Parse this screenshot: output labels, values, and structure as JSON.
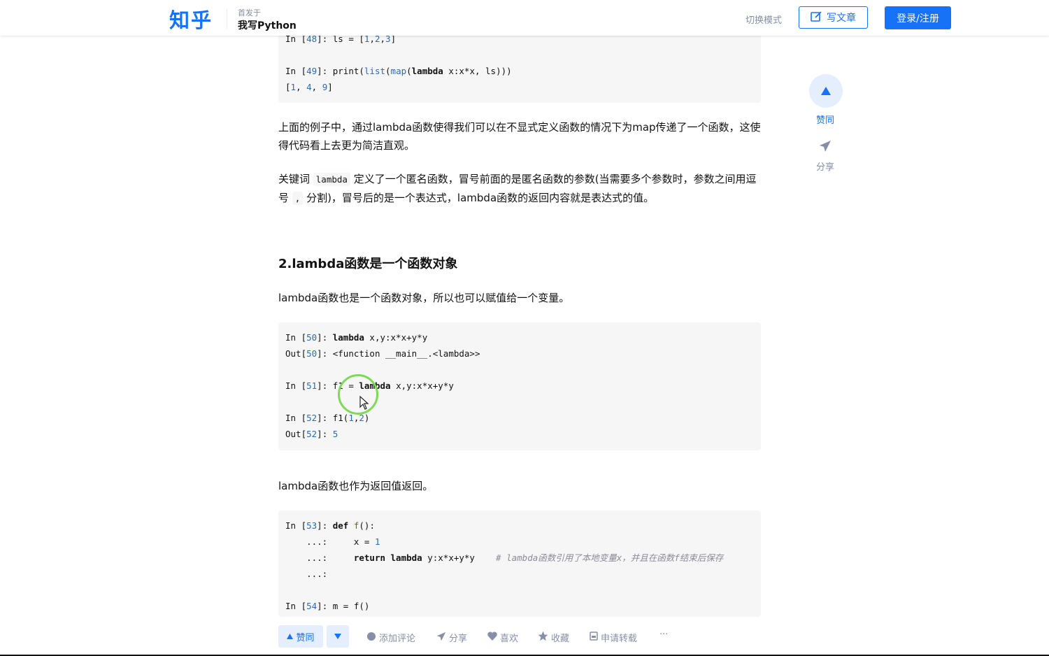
{
  "header": {
    "logo": "知乎",
    "column_label": "首发于",
    "column_name": "我写Python",
    "switch_mode": "切换模式",
    "write_label": "写文章",
    "login_label": "登录/注册"
  },
  "code_top": {
    "lines": [
      "In [48]: ls = [1,2,3]",
      "",
      "In [49]: print(list(map(lambda x:x*x, ls)))",
      "[1, 4, 9]"
    ]
  },
  "para1": "上面的例子中，通过lambda函数使得我们可以在不显式定义函数的情况下为map传递了一个函数，这使得代码看上去更为简洁直观。",
  "para2": {
    "prefix": "关键词 ",
    "code": "lambda",
    "suffix1": " 定义了一个匿名函数，冒号前面的是匿名函数的参数(当需要多个参数时，参数之间用逗号 ",
    "code2": ",",
    "suffix2": " 分割)，冒号后的是一个表达式，lambda函数的返回内容就是表达式的值。"
  },
  "section_title": "2.lambda函数是一个函数对象",
  "para3": "lambda函数也是一个函数对象，所以也可以赋值给一个变量。",
  "code_mid": {
    "lines": [
      "In [50]: lambda x,y:x*x+y*y",
      "Out[50]: <function __main__.<lambda>>",
      "",
      "In [51]: f1 = lambda x,y:x*x+y*y",
      "",
      "In [52]: f1(1,2)",
      "Out[52]: 5"
    ]
  },
  "para4": "lambda函数也作为返回值返回。",
  "code_bottom": {
    "lines": [
      "In [53]: def f():",
      "    ...:     x = 1",
      "    ...:     return lambda y:x*x+y*y    # lambda函数引用了本地变量x，并且在函数f结束后保存",
      "    ...:",
      "",
      "In [54]: m = f()"
    ]
  },
  "side": {
    "vote_label": "赞同",
    "share_label": "分享"
  },
  "bottom": {
    "vote_label": "赞同",
    "comment_label": "添加评论",
    "share_label": "分享",
    "like_label": "喜欢",
    "collect_label": "收藏",
    "repost_label": "申请转载",
    "more_label": "···"
  },
  "colors": {
    "brand": "#1772f6",
    "muted": "#8590a6",
    "code_bg": "#f6f6f6",
    "highlight_ring": "#7ed957"
  }
}
